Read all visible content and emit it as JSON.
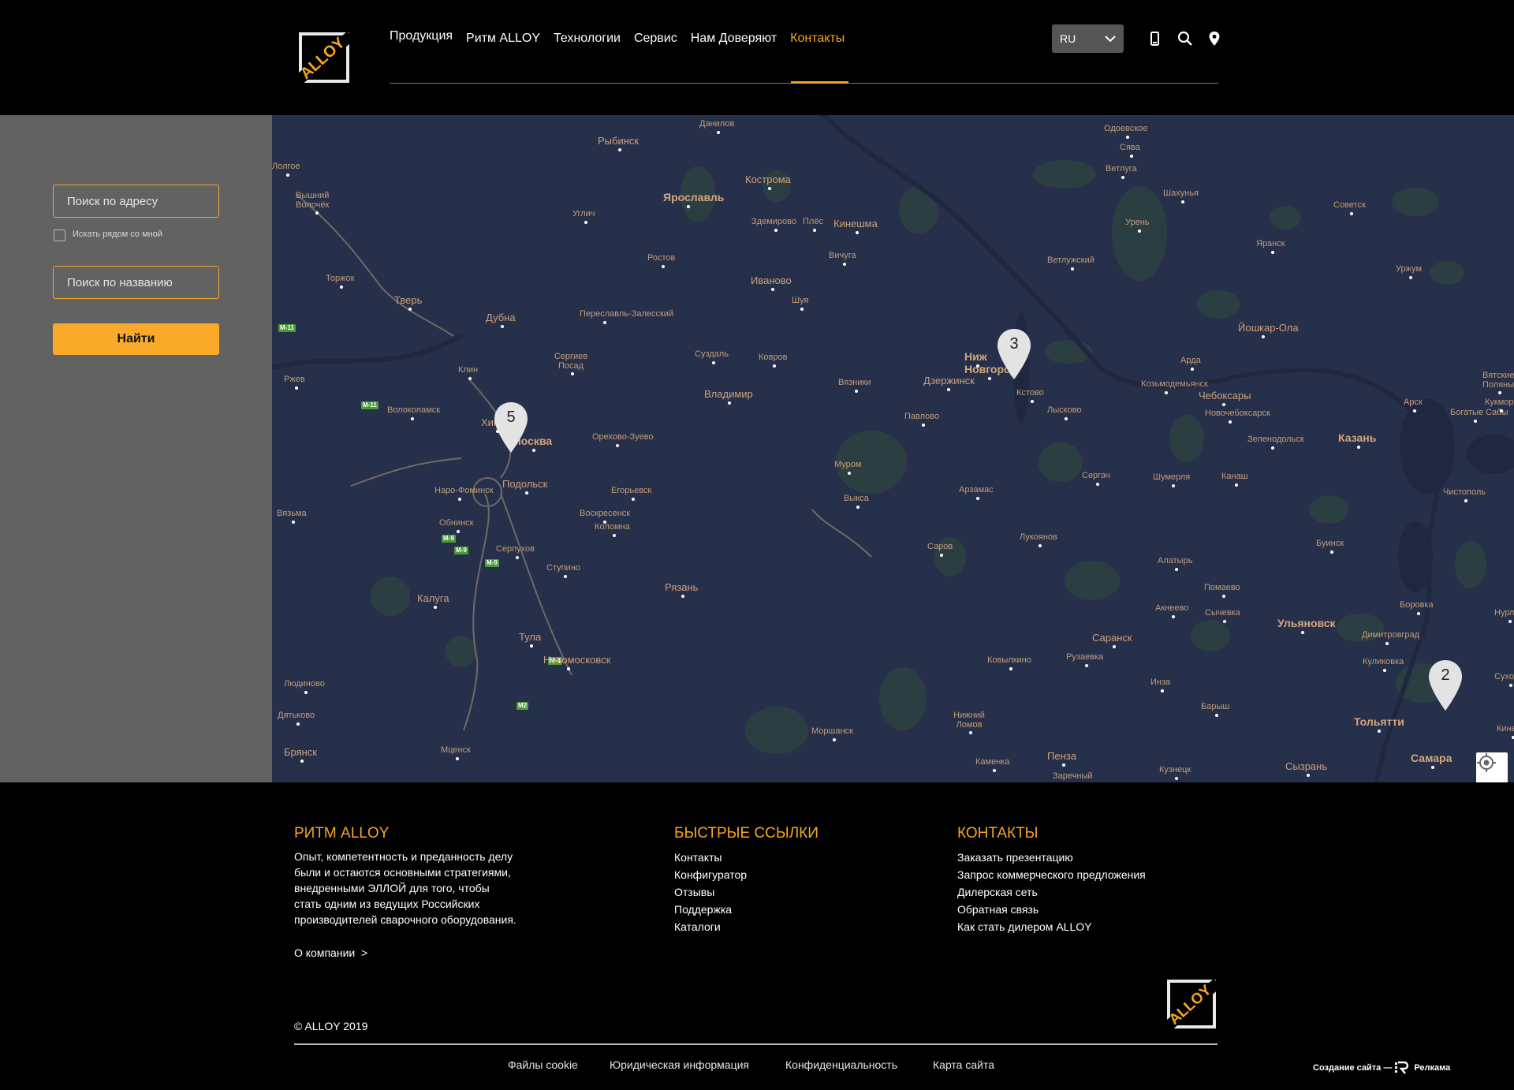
{
  "header": {
    "logo_text": "ALLOY",
    "nav": [
      "Продукция",
      "Ритм ALLOY",
      "Технологии",
      "Сервис",
      "Нам Доверяют",
      "Контакты"
    ],
    "active_nav": "Контакты",
    "language": "RU",
    "icons": [
      "phone-icon",
      "search-icon",
      "location-pin-icon"
    ],
    "accent_color": "#f6a623"
  },
  "search_panel": {
    "address_placeholder": "Поиск по адресу",
    "nearby_label": "Искать рядом со мной",
    "nearby_checked": false,
    "name_placeholder": "Поиск по названию",
    "find_button": "Найти"
  },
  "map": {
    "clusters": [
      {
        "label": "5",
        "near": "Москва"
      },
      {
        "label": "3",
        "near": "Нижний Новгород"
      },
      {
        "label": "2",
        "near": "Тольятти"
      }
    ],
    "road_labels": [
      "M-11",
      "M-11",
      "M-9",
      "M-9",
      "M-9",
      "M-4",
      "M2"
    ],
    "cities": [
      "Данилов",
      "Одоевское",
      "Рыбинск",
      "Сява",
      "Ветлуга",
      "Кострома",
      "Шахунья",
      "Ярославль",
      "Углич",
      "Лолгое",
      "Вышний Волочёк",
      "Советск",
      "Здемирово",
      "Плёс",
      "Кинешма",
      "Урень",
      "Яранск",
      "Ростов",
      "Вичуга",
      "Ветлужский",
      "Уржум",
      "Торжок",
      "Иваново",
      "Тверь",
      "Шуя",
      "Дубна",
      "Переславль-Залесский",
      "Йошкар-Ола",
      "Сергиев Посад",
      "Суздаль",
      "Ковров",
      "Ниж",
      "Новгород",
      "Арда",
      "Клин",
      "Ржев",
      "Вязники",
      "Дзержинск",
      "Кстово",
      "Козьмодемьянск",
      "Чебоксары",
      "Вятские Поляны",
      "Владимир",
      "Лысково",
      "Новочебоксарск",
      "Волоколамск",
      "Павлово",
      "Арск",
      "Богатые Сабы",
      "Кукмор",
      "Химки",
      "Москва",
      "Орехово-Зуево",
      "Зеленодольск",
      "Казань",
      "Муром",
      "Сергач",
      "Шумерля",
      "Канаш",
      "Подольск",
      "Егорьевск",
      "Выкса",
      "Арзамас",
      "Чистополь",
      "Наро-Фоминск",
      "Воскресенск",
      "Вязьма",
      "Коломна",
      "Обнинск",
      "Лукоянов",
      "Буинск",
      "Серпухов",
      "Саров",
      "Алатырь",
      "Ступино",
      "Помаево",
      "Рязань",
      "Калуга",
      "Акнеево",
      "Сычевка",
      "Боровка",
      "Ульяновск",
      "Нурлат",
      "Тула",
      "Саранск",
      "Димитровград",
      "Рузаевка",
      "Новомосковск",
      "Ковылкино",
      "Куликовка",
      "Людиново",
      "Инза",
      "Сухода",
      "Барыш",
      "Дятьково",
      "Нижний Ломов",
      "Тольятти",
      "Моршанск",
      "Кинель",
      "Брянск",
      "Мценск",
      "Пенза",
      "Заречный",
      "Каменка",
      "Кузнецк",
      "Сызрань",
      "Самара"
    ]
  },
  "footer": {
    "col1": {
      "title": "РИТМ ALLOY",
      "lines": [
        "Опыт, компетентность и преданность делу",
        "были и остаются основными стратегиями,",
        "внедренными ЭЛЛОЙ для того, чтобы",
        "стать одним из ведущих Российских",
        "производителей сварочного оборудования."
      ],
      "link": "О компании  >"
    },
    "col2": {
      "title": "БЫСТРЫЕ ССЫЛКИ",
      "links": [
        "Контакты",
        "Конфигуратор",
        "Отзывы",
        "Поддержка",
        "Каталоги"
      ]
    },
    "col3": {
      "title": "КОНТАКТЫ",
      "links": [
        "Заказать презентацию",
        "Запрос коммерческого предложения",
        "Дилерская сеть",
        "Обратная связь",
        "Как стать дилером ALLOY"
      ]
    },
    "copyright": "© ALLOY 2019",
    "bottom_links": [
      "Файлы cookie",
      "Юридическая информация",
      "Конфиденциальность",
      "Карта сайта"
    ],
    "maker_text": "Создание сайта —",
    "maker_name": "Релкама"
  }
}
